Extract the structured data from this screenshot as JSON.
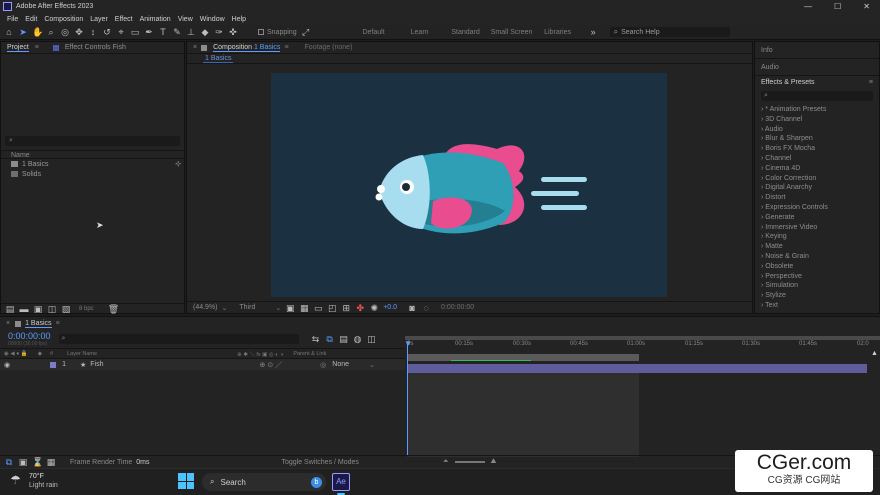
{
  "window": {
    "title": "Adobe After Effects 2023",
    "controls": [
      "—",
      "☐",
      "✕"
    ]
  },
  "menu": [
    "File",
    "Edit",
    "Composition",
    "Layer",
    "Effect",
    "Animation",
    "View",
    "Window",
    "Help"
  ],
  "toolbar": {
    "snapping_label": "Snapping",
    "workspaces": [
      "Default",
      "Learn",
      "Standard",
      "Small Screen",
      "Libraries"
    ],
    "more_label": "»",
    "search_placeholder": "Search Help"
  },
  "project": {
    "tabs": [
      "Project",
      "Effect Controls Fish"
    ],
    "column_name": "Name",
    "items": [
      {
        "name": "1 Basics",
        "type": "composition"
      },
      {
        "name": "Solids",
        "type": "folder"
      }
    ],
    "footer_bpc": "8 bpc"
  },
  "composition": {
    "tabs": [
      "Composition",
      "Footage (none)"
    ],
    "active_comp_name": "1 Basics",
    "breadcrumb": "1 Basics",
    "zoom": "(44.9%)",
    "resolution": "Third",
    "exposure": "+0.0",
    "timecode": "0:00:00:00"
  },
  "right_panel": {
    "sections": [
      "Info",
      "Audio"
    ],
    "effects_title": "Effects & Presets",
    "effects": [
      "* Animation Presets",
      "3D Channel",
      "Audio",
      "Blur & Sharpen",
      "Boris FX Mocha",
      "Channel",
      "Cinema 4D",
      "Color Correction",
      "Digital Anarchy",
      "Distort",
      "Expression Controls",
      "Generate",
      "Immersive Video",
      "Keying",
      "Matte",
      "Noise & Grain",
      "Obsolete",
      "Perspective",
      "Simulation",
      "Stylize",
      "Text"
    ]
  },
  "timeline": {
    "tab": "1 Basics",
    "timecode": "0:00:00:00",
    "timecode_sub": "00000 (30.00 fps)",
    "columns": {
      "num": "#",
      "layer_name": "Layer Name",
      "parent": "Parent & Link"
    },
    "layers": [
      {
        "num": "1",
        "name": "Fish",
        "parent": "None"
      }
    ],
    "ruler": [
      "0s",
      "00:15s",
      "00:30s",
      "00:45s",
      "01:00s",
      "01:15s",
      "01:30s",
      "01:45s",
      "02:0"
    ],
    "frame_render_label": "Frame Render Time",
    "frame_render_value": "0ms",
    "toggle_label": "Toggle Switches / Modes"
  },
  "taskbar": {
    "weather_temp": "70°F",
    "weather_desc": "Light rain",
    "search_label": "Search",
    "app_label": "Ae"
  },
  "watermark": {
    "main": "CGer.com",
    "sub": "CG资源 CG网站"
  },
  "colors": {
    "accent": "#5a9cff",
    "comp_bg": "#1b3040",
    "layer_bar": "#5e5c9c",
    "fish_pink": "#e94c8f",
    "fish_teal": "#2e9fb4",
    "fish_light": "#a8dcef"
  }
}
